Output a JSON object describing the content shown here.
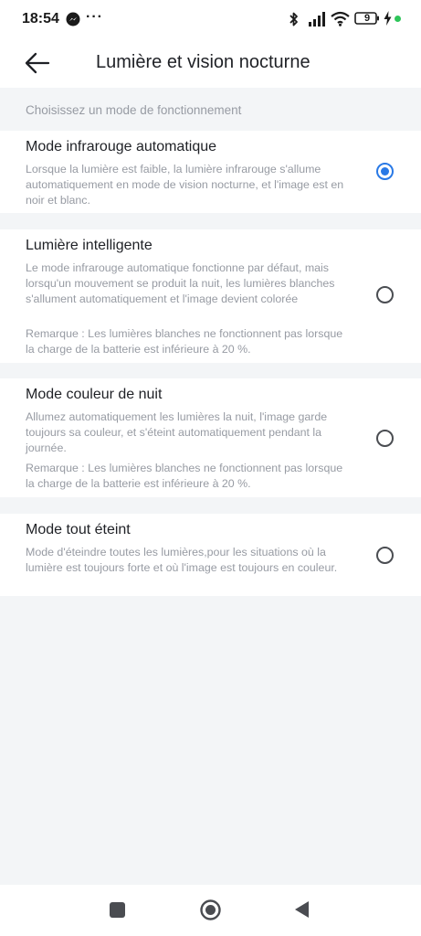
{
  "status_bar": {
    "time": "18:54",
    "more": "···",
    "battery_level": "9",
    "icons": [
      "messenger-icon",
      "bluetooth-icon",
      "signal-icon",
      "wifi-icon",
      "battery-icon",
      "charging-icon"
    ],
    "charge_dot_color": "#2ec55a"
  },
  "header": {
    "title": "Lumière et vision nocturne",
    "back_icon": "arrow-left-icon"
  },
  "section_label": "Choisissez un mode de fonctionnement",
  "options": [
    {
      "title": "Mode infrarouge automatique",
      "description": "Lorsque la lumière est faible, la lumière infrarouge s'allume automatiquement en mode de vision nocturne, et l'image est en noir et blanc.",
      "selected": true
    },
    {
      "title": "Lumière intelligente",
      "description": "Le mode infrarouge automatique fonctionne par défaut, mais lorsqu'un mouvement se produit la nuit, les lumières blanches s'allument automatiquement et l'image devient colorée",
      "note": "Remarque : Les lumières blanches ne fonctionnent pas lorsque la charge de la batterie est inférieure à 20 %.",
      "selected": false
    },
    {
      "title": "Mode couleur de nuit",
      "description": "Allumez automatiquement les lumières la nuit, l'image garde toujours sa couleur, et s'éteint automatiquement pendant la journée.",
      "note": "Remarque : Les lumières blanches ne fonctionnent pas lorsque la charge de la batterie est inférieure à 20 %.",
      "selected": false
    },
    {
      "title": "Mode tout éteint",
      "description": "Mode d'éteindre toutes les lumières,pour les situations où la lumière est toujours forte et où l'image est toujours en couleur.",
      "selected": false
    }
  ],
  "colors": {
    "accent": "#2979e6",
    "background": "#f3f5f7",
    "card": "#ffffff",
    "secondary_text": "#979ba3"
  },
  "nav_bar": {
    "icons": [
      "recents-icon",
      "home-icon",
      "back-icon"
    ]
  }
}
